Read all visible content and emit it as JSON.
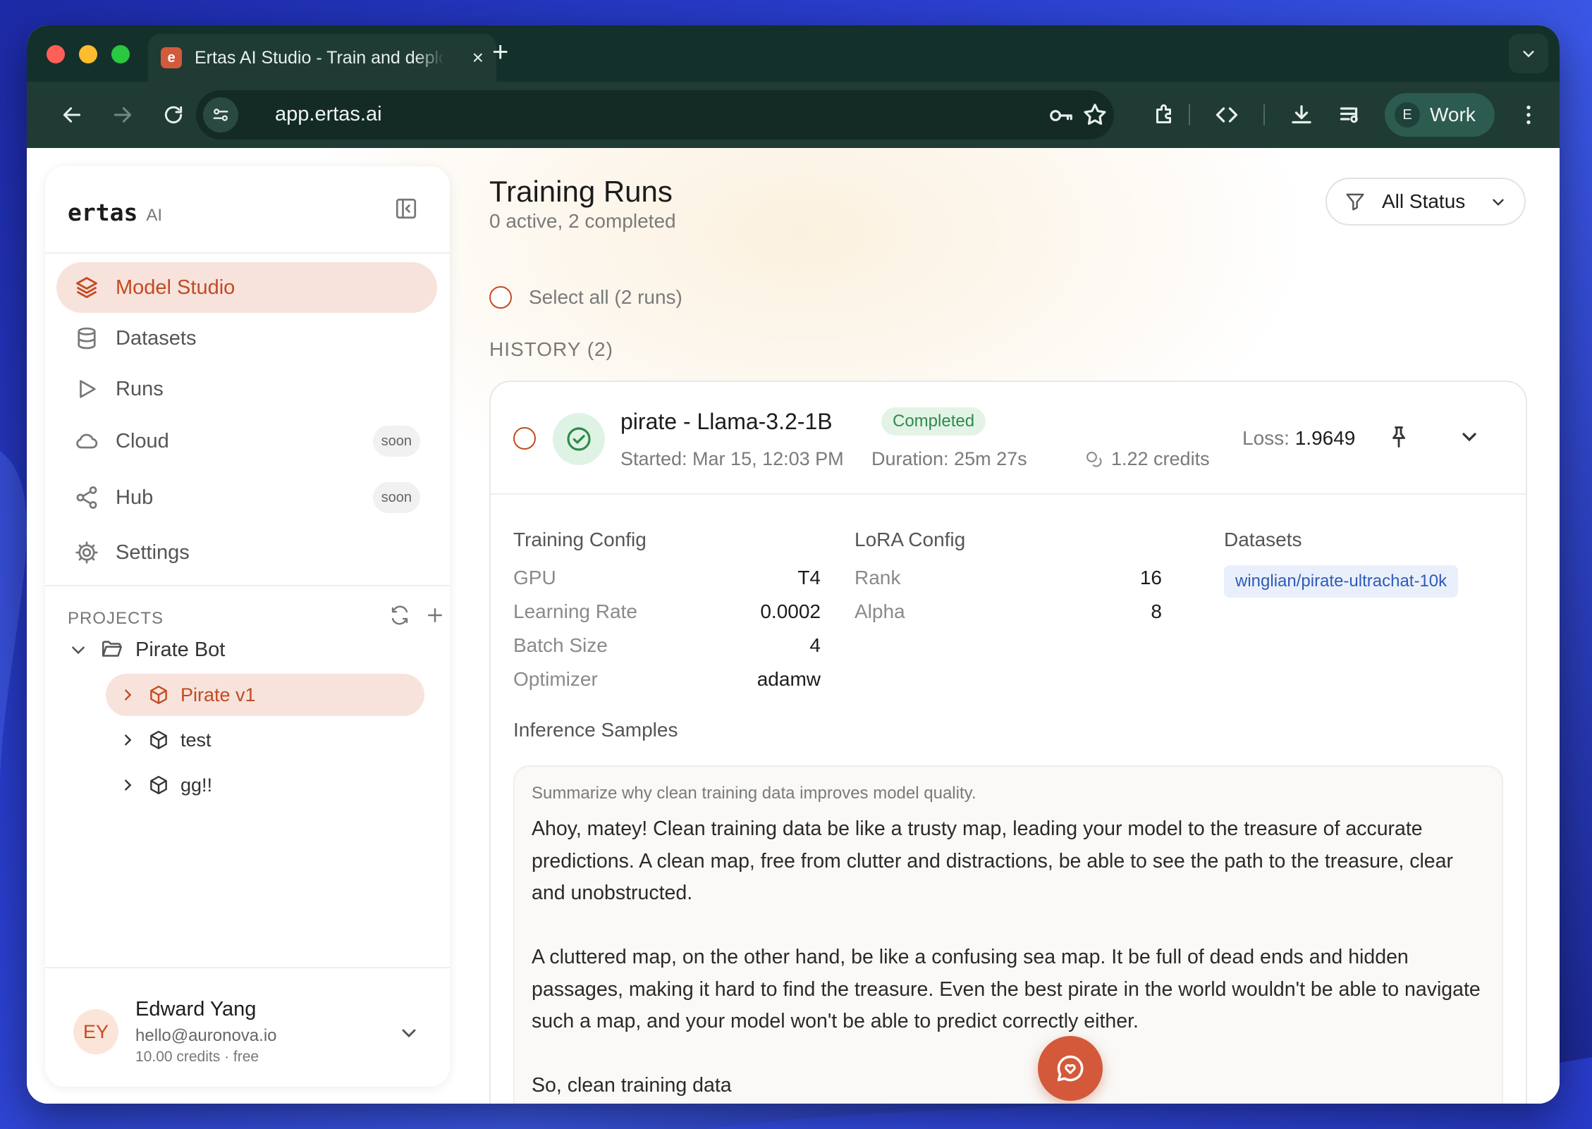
{
  "browser": {
    "tab_title": "Ertas AI Studio - Train and deploy",
    "favicon_letter": "e",
    "url": "app.ertas.ai",
    "profile_initial": "E",
    "profile_label": "Work"
  },
  "sidebar": {
    "brand_name": "ertas",
    "brand_suffix": "AI",
    "nav": [
      {
        "label": "Model Studio",
        "icon": "layers-icon",
        "active": true
      },
      {
        "label": "Datasets",
        "icon": "database-icon"
      },
      {
        "label": "Runs",
        "icon": "play-icon"
      },
      {
        "label": "Cloud",
        "icon": "cloud-icon",
        "badge": "soon"
      },
      {
        "label": "Hub",
        "icon": "share-icon",
        "badge": "soon"
      },
      {
        "label": "Settings",
        "icon": "gear-icon"
      }
    ],
    "projects_header": "PROJECTS",
    "project_folder": "Pirate Bot",
    "project_items": [
      "Pirate v1",
      "test",
      "gg!!"
    ],
    "user": {
      "initials": "EY",
      "name": "Edward Yang",
      "email": "hello@auronova.io",
      "credits": "10.00 credits · free"
    }
  },
  "main": {
    "title": "Training Runs",
    "subtitle": "0 active, 2 completed",
    "filter_label": "All Status",
    "select_all": "Select all (2 runs)",
    "history_label": "HISTORY (2)"
  },
  "run": {
    "title": "pirate - Llama-3.2-1B",
    "status": "Completed",
    "started": "Started: Mar 15, 12:03 PM",
    "duration": "Duration: 25m 27s",
    "credits": "1.22 credits",
    "loss_label": "Loss:",
    "loss_value": "1.9649",
    "training_config_title": "Training Config",
    "training_config": [
      {
        "k": "GPU",
        "v": "T4"
      },
      {
        "k": "Learning Rate",
        "v": "0.0002"
      },
      {
        "k": "Batch Size",
        "v": "4"
      },
      {
        "k": "Optimizer",
        "v": "adamw"
      }
    ],
    "lora_config_title": "LoRA Config",
    "lora_config": [
      {
        "k": "Rank",
        "v": "16"
      },
      {
        "k": "Alpha",
        "v": "8"
      }
    ],
    "datasets_title": "Datasets",
    "dataset": "winglian/pirate-ultrachat-10k",
    "inference_title": "Inference Samples",
    "inference_prompt": "Summarize why clean training data improves model quality.",
    "inference_paragraphs": [
      "Ahoy, matey!  Clean training data be like a trusty map, leading your model to the treasure of accurate predictions.  A clean map, free from clutter and distractions, be able to see the path to the treasure, clear and unobstructed.",
      "A cluttered map, on the other hand, be like a confusing sea map.  It be full of dead ends and hidden passages, making it hard to find the treasure.  Even the best pirate in the world wouldn't be able to navigate such a map, and your model won't be able to predict correctly either.",
      "So, clean training data"
    ]
  },
  "colors": {
    "accent": "#c44a22",
    "accent_soft": "#f7e3dc",
    "chrome_dark": "#14302a",
    "chrome": "#1f3b34",
    "success": "#2f8a4b",
    "fab": "#d4593a"
  }
}
